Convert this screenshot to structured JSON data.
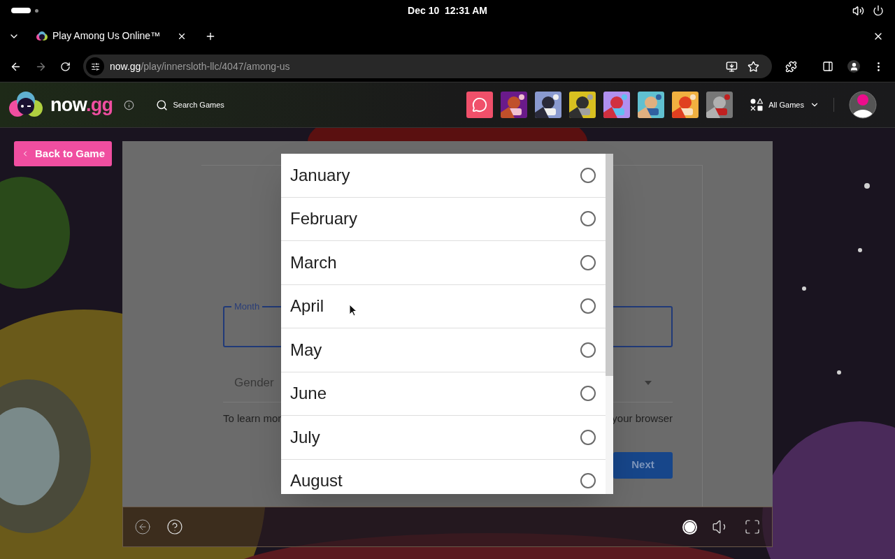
{
  "system_bar": {
    "date_time": "Dec 10  12:31 AM"
  },
  "browser": {
    "tab": {
      "title": "Play Among Us Online™",
      "selected": true
    },
    "url": {
      "host": "now.gg",
      "path": "/play/innersloth-llc/4047/among-us"
    }
  },
  "site_header": {
    "logo": {
      "name": "now",
      "suffix": ".gg"
    },
    "search": {
      "placeholder": "Search Games"
    },
    "thumbnails": [
      {
        "kind": "chat"
      },
      {
        "kind": "picture"
      },
      {
        "kind": "picture"
      },
      {
        "kind": "picture"
      },
      {
        "kind": "picture"
      },
      {
        "kind": "picture"
      },
      {
        "kind": "picture"
      },
      {
        "kind": "picture"
      }
    ],
    "all_games": "All Games"
  },
  "back_button": "Back to Game",
  "form": {
    "month_field": {
      "label": "Month"
    },
    "gender_field": {
      "placeholder": "Gender"
    },
    "notice_left": "To learn mor",
    "notice_right": "your browser",
    "next_button": "Next"
  },
  "month_picker": {
    "options": [
      {
        "label": "January",
        "selected": false
      },
      {
        "label": "February",
        "selected": false
      },
      {
        "label": "March",
        "selected": false
      },
      {
        "label": "April",
        "selected": false
      },
      {
        "label": "May",
        "selected": false
      },
      {
        "label": "June",
        "selected": false
      },
      {
        "label": "July",
        "selected": false
      },
      {
        "label": "August",
        "selected": false
      }
    ]
  }
}
